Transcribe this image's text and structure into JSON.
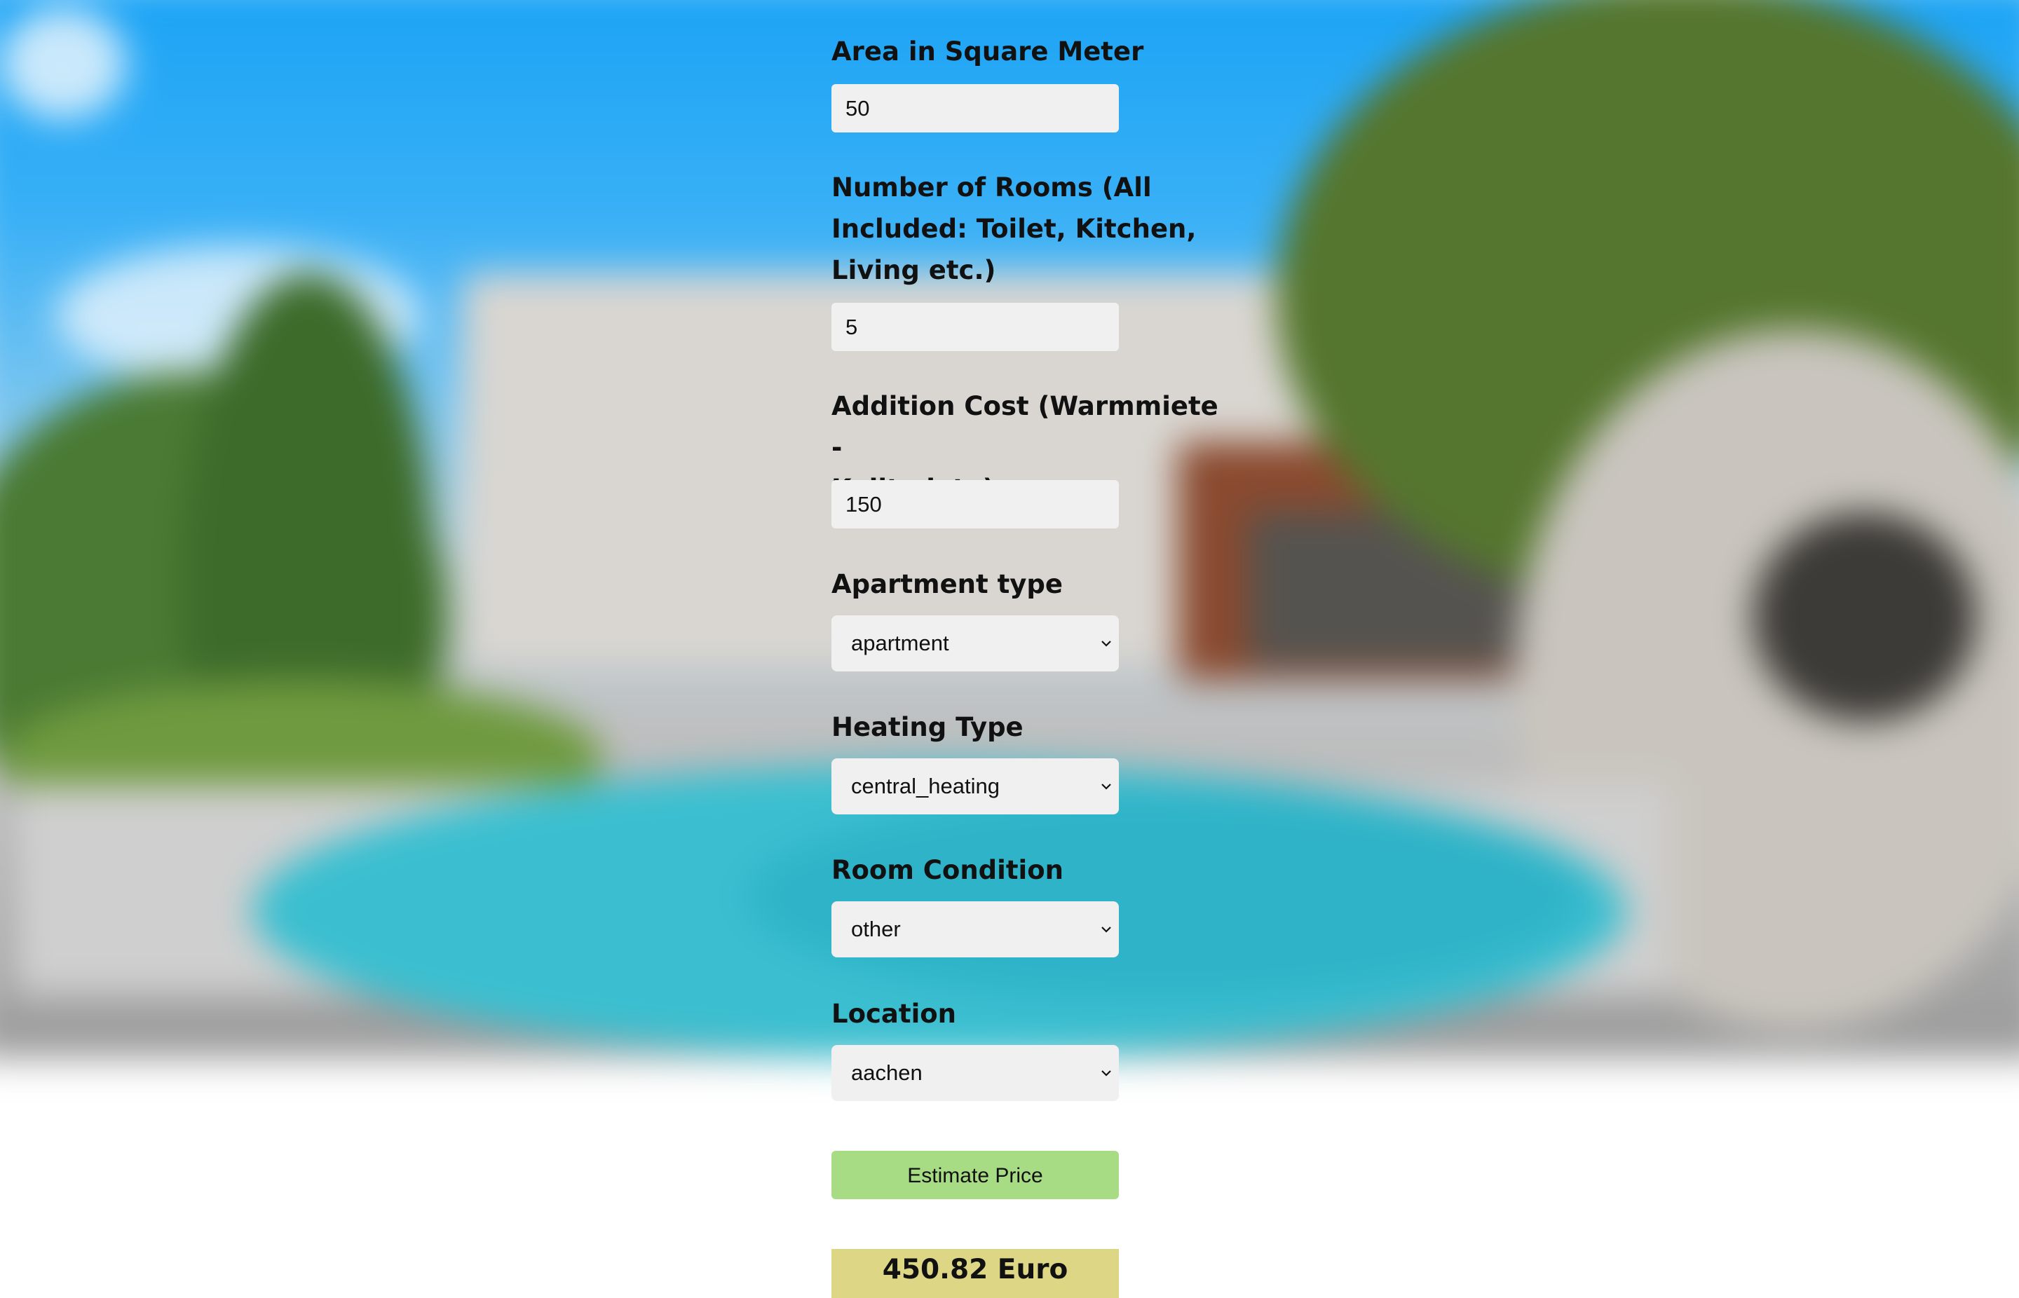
{
  "form": {
    "area": {
      "label": "Area in Square Meter",
      "value": "50"
    },
    "rooms": {
      "label_lines": [
        "Number of Rooms (All",
        "Included: Toilet, Kitchen,",
        "Living etc.)"
      ],
      "value": "5"
    },
    "additional_cost": {
      "label_lines": [
        "Addition Cost (Warmmiete -",
        "Kalitmiete)"
      ],
      "value": "150"
    },
    "apartment_type": {
      "label": "Apartment type",
      "selected": "apartment"
    },
    "heating_type": {
      "label": "Heating Type",
      "selected": "central_heating"
    },
    "room_condition": {
      "label": "Room Condition",
      "selected": "other"
    },
    "location": {
      "label": "Location",
      "selected": "aachen"
    }
  },
  "estimate_button_label": "Estimate Price",
  "result_text": "450.82 Euro",
  "colors": {
    "input_bg": "#f0f0f0",
    "button_bg": "#a7dc85",
    "result_bg": "#ddd684",
    "sky": "#1aa3f5",
    "pool": "#3bbfd0"
  }
}
